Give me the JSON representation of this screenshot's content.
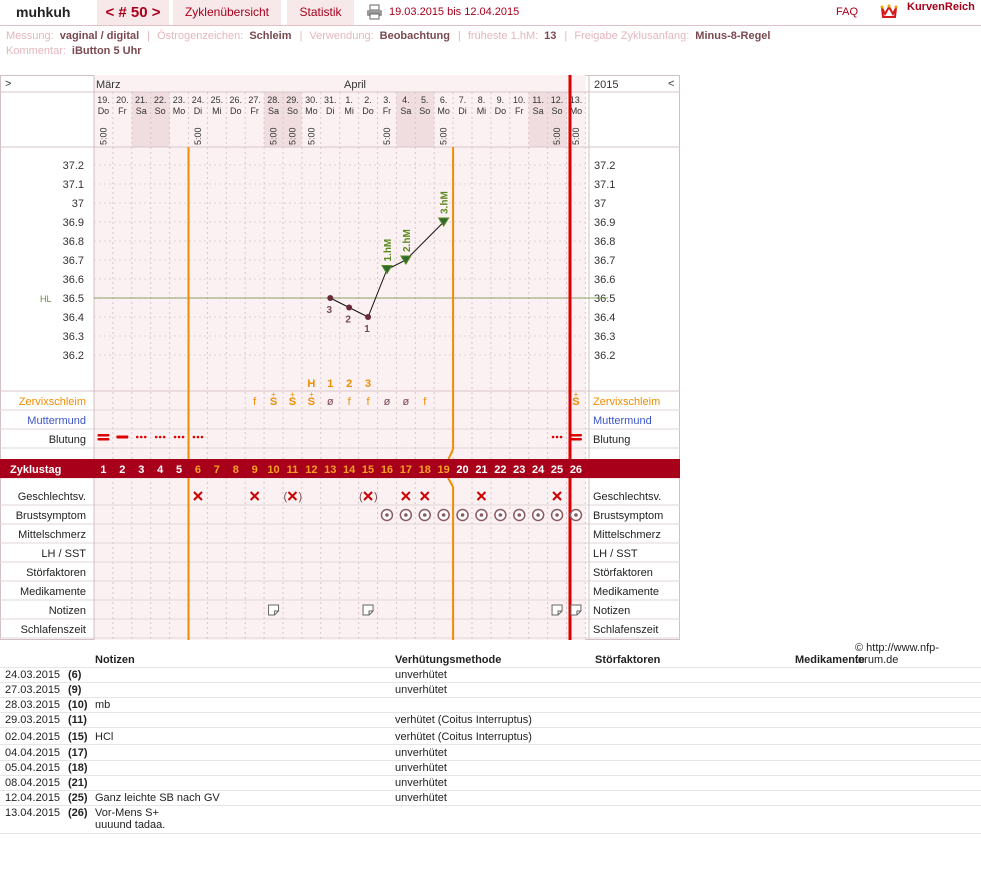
{
  "header": {
    "username": "muhkuh",
    "cycle_label": "< # 50 >",
    "tab_overview": "Zyklenübersicht",
    "tab_statistics": "Statistik",
    "date_range": "19.03.2015 bis 12.04.2015",
    "faq": "FAQ",
    "logo_text": "KurvenReich",
    "logo_icon": "crown-icon",
    "print_icon": "printer-icon"
  },
  "info": {
    "messung_label": "Messung:",
    "messung": "vaginal / digital",
    "oestrogen_label": "Östrogenzeichen:",
    "oestrogen": "Schleim",
    "verwendung_label": "Verwendung:",
    "verwendung": "Beobachtung",
    "fruehe_label": "früheste 1.hM:",
    "fruehe": "13",
    "freigabe_label": "Freigabe Zyklusanfang:",
    "freigabe": "Minus-8-Regel",
    "kommentar_label": "Kommentar:",
    "kommentar": "iButton 5 Uhr"
  },
  "chart": {
    "nav_left": ">",
    "nav_right": "<",
    "month1": "März",
    "month2": "April",
    "year": "2015",
    "time": "5:00",
    "days": [
      {
        "n": "19.",
        "d": "Do"
      },
      {
        "n": "20.",
        "d": "Fr"
      },
      {
        "n": "21.",
        "d": "Sa"
      },
      {
        "n": "22.",
        "d": "So"
      },
      {
        "n": "23.",
        "d": "Mo"
      },
      {
        "n": "24.",
        "d": "Di"
      },
      {
        "n": "25.",
        "d": "Mi"
      },
      {
        "n": "26.",
        "d": "Do"
      },
      {
        "n": "27.",
        "d": "Fr"
      },
      {
        "n": "28.",
        "d": "Sa"
      },
      {
        "n": "29.",
        "d": "So"
      },
      {
        "n": "30.",
        "d": "Mo"
      },
      {
        "n": "31.",
        "d": "Di"
      },
      {
        "n": "1.",
        "d": "Mi"
      },
      {
        "n": "2.",
        "d": "Do"
      },
      {
        "n": "3.",
        "d": "Fr"
      },
      {
        "n": "4.",
        "d": "Sa"
      },
      {
        "n": "5.",
        "d": "So"
      },
      {
        "n": "6.",
        "d": "Mo"
      },
      {
        "n": "7.",
        "d": "Di"
      },
      {
        "n": "8.",
        "d": "Mi"
      },
      {
        "n": "9.",
        "d": "Do"
      },
      {
        "n": "10.",
        "d": "Fr"
      },
      {
        "n": "11.",
        "d": "Sa"
      },
      {
        "n": "12.",
        "d": "So"
      },
      {
        "n": "13.",
        "d": "Mo"
      }
    ],
    "time_cols": [
      1,
      6,
      10,
      11,
      12,
      16,
      19,
      25,
      26
    ],
    "y_ticks": [
      "37.2",
      "37.1",
      "37",
      "36.9",
      "36.8",
      "36.7",
      "36.6",
      "36.5",
      "36.4",
      "36.3",
      "36.2"
    ],
    "hl_label": "HL",
    "temps": [
      {
        "day": 13,
        "t": 36.5,
        "label": "3"
      },
      {
        "day": 14,
        "t": 36.45,
        "label": "2"
      },
      {
        "day": 15,
        "t": 36.4,
        "label": "1"
      },
      {
        "day": 16,
        "t": 36.65,
        "label": "1.hM"
      },
      {
        "day": 17,
        "t": 36.7,
        "label": "2.hM"
      },
      {
        "day": 19,
        "t": 36.9,
        "label": "3.hM"
      }
    ],
    "peak_labels": [
      {
        "day": 12,
        "t": "H"
      },
      {
        "day": 13,
        "t": "1"
      },
      {
        "day": 14,
        "t": "2"
      },
      {
        "day": 15,
        "t": "3"
      }
    ],
    "mucus": [
      {
        "day": 9,
        "t": "f"
      },
      {
        "day": 10,
        "t": "S"
      },
      {
        "day": 11,
        "t": "S"
      },
      {
        "day": 12,
        "t": "S"
      },
      {
        "day": 13,
        "t": "ø"
      },
      {
        "day": 14,
        "t": "f"
      },
      {
        "day": 15,
        "t": "f"
      },
      {
        "day": 16,
        "t": "ø"
      },
      {
        "day": 17,
        "t": "ø"
      },
      {
        "day": 18,
        "t": "f"
      },
      {
        "day": 26,
        "t": "S"
      }
    ],
    "bleeding": [
      {
        "day": 1,
        "t": "heavy"
      },
      {
        "day": 2,
        "t": "medium"
      },
      {
        "day": 3,
        "t": "light"
      },
      {
        "day": 4,
        "t": "light"
      },
      {
        "day": 5,
        "t": "light"
      },
      {
        "day": 6,
        "t": "light"
      },
      {
        "day": 25,
        "t": "light"
      },
      {
        "day": 26,
        "t": "heavy"
      }
    ],
    "intercourse": [
      {
        "day": 6,
        "t": "x"
      },
      {
        "day": 9,
        "t": "x"
      },
      {
        "day": 11,
        "t": "(x)"
      },
      {
        "day": 15,
        "t": "(x)"
      },
      {
        "day": 17,
        "t": "x"
      },
      {
        "day": 18,
        "t": "x"
      },
      {
        "day": 21,
        "t": "x"
      },
      {
        "day": 25,
        "t": "x"
      }
    ],
    "breast_from": 16,
    "notes_days": [
      10,
      15,
      25,
      26
    ],
    "cycle_days": [
      "1",
      "2",
      "3",
      "4",
      "5",
      "6",
      "7",
      "8",
      "9",
      "10",
      "11",
      "12",
      "13",
      "14",
      "15",
      "16",
      "17",
      "18",
      "19",
      "20",
      "21",
      "22",
      "23",
      "24",
      "25",
      "26"
    ],
    "rows": {
      "zervix": "Zervixschleim",
      "mutter": "Muttermund",
      "blutung": "Blutung",
      "zyklustag": "Zyklustag",
      "gv": "Geschlechtsv.",
      "brust": "Brustsymptom",
      "mittel": "Mittelschmerz",
      "lh": "LH / SST",
      "stoer": "Störfaktoren",
      "medi": "Medikamente",
      "notizen": "Notizen",
      "schlaf": "Schlafenszeit"
    }
  },
  "colors": {
    "accent": "#a8001a",
    "orange": "#f08c00",
    "green": "#5e8a22",
    "brown": "#7a4a50",
    "blue": "#3c55c8"
  },
  "footer": "© http://www.nfp-forum.de",
  "notes_table": {
    "headers": {
      "notizen": "Notizen",
      "methode": "Verhütungsmethode",
      "stoer": "Störfaktoren",
      "medi": "Medikamente"
    },
    "rows": [
      {
        "date": "24.03.2015",
        "day": "(6)",
        "note": "",
        "method": "unverhütet"
      },
      {
        "date": "27.03.2015",
        "day": "(9)",
        "note": "",
        "method": "unverhütet"
      },
      {
        "date": "28.03.2015",
        "day": "(10)",
        "note": "mb",
        "method": ""
      },
      {
        "date": "29.03.2015",
        "day": "(11)",
        "note": "",
        "method": "verhütet (Coitus Interruptus)"
      },
      {
        "date": "02.04.2015",
        "day": "(15)",
        "note": "HCl",
        "method": "verhütet (Coitus Interruptus)"
      },
      {
        "date": "04.04.2015",
        "day": "(17)",
        "note": "",
        "method": "unverhütet"
      },
      {
        "date": "05.04.2015",
        "day": "(18)",
        "note": "",
        "method": "unverhütet"
      },
      {
        "date": "08.04.2015",
        "day": "(21)",
        "note": "",
        "method": "unverhütet"
      },
      {
        "date": "12.04.2015",
        "day": "(25)",
        "note": "Ganz leichte SB nach GV",
        "method": "unverhütet"
      },
      {
        "date": "13.04.2015",
        "day": "(26)",
        "note": "Vor-Mens S+",
        "note2": "uuuund tadaa.",
        "method": ""
      }
    ]
  }
}
